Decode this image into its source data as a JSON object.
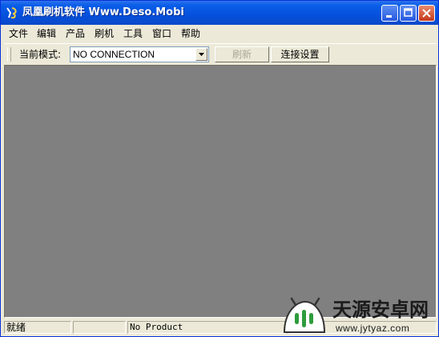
{
  "window": {
    "title": "凤凰刷机软件 Www.Deso.Mobi",
    "app_icon": "app-logo-icon",
    "buttons": {
      "minimize": "minimize-icon",
      "maximize": "maximize-icon",
      "close": "close-icon"
    },
    "colors": {
      "titlebar": "#0a5ee8",
      "client": "#808080",
      "chrome": "#ece9d8"
    }
  },
  "menu": {
    "items": [
      {
        "label": "文件"
      },
      {
        "label": "编辑"
      },
      {
        "label": "产品"
      },
      {
        "label": "刷机"
      },
      {
        "label": "工具"
      },
      {
        "label": "窗口"
      },
      {
        "label": "帮助"
      }
    ]
  },
  "toolbar": {
    "mode_label": "当前模式:",
    "mode_value": "NO CONNECTION",
    "refresh_label": "刷新",
    "refresh_enabled": false,
    "connect_label": "连接设置"
  },
  "status": {
    "ready": "就绪",
    "panel2": "",
    "product": "No Product",
    "panel4": ""
  },
  "watermark": {
    "logo": "android-logo-icon",
    "text": "天源安卓网",
    "url": "www.jytyaz.com"
  }
}
